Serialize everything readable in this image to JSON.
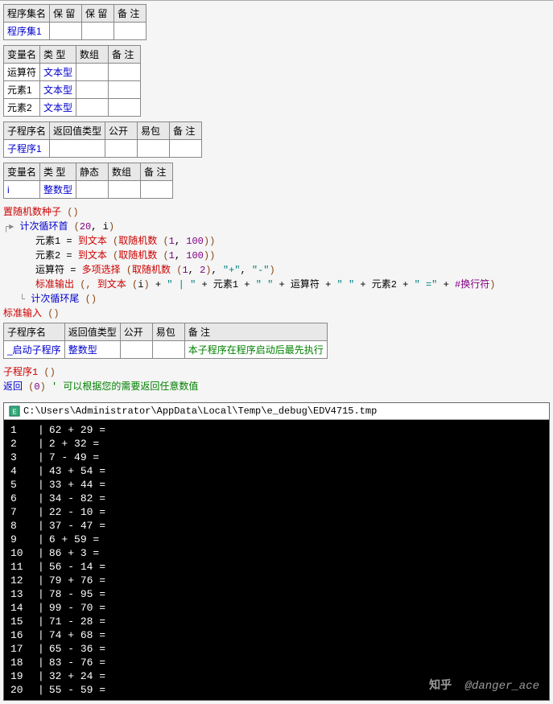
{
  "table1": {
    "headers": [
      "程序集名",
      "保 留",
      "保 留",
      "备 注"
    ],
    "rows": [
      [
        "程序集1",
        "",
        "",
        ""
      ]
    ]
  },
  "table2": {
    "headers": [
      "变量名",
      "类 型",
      "数组",
      "备 注"
    ],
    "rows": [
      [
        "运算符",
        "文本型",
        "",
        ""
      ],
      [
        "元素1",
        "文本型",
        "",
        ""
      ],
      [
        "元素2",
        "文本型",
        "",
        ""
      ]
    ]
  },
  "table3": {
    "headers": [
      "子程序名",
      "返回值类型",
      "公开",
      "易包",
      "备 注"
    ],
    "rows": [
      [
        "子程序1",
        "",
        "",
        "",
        ""
      ]
    ]
  },
  "table4": {
    "headers": [
      "变量名",
      "类 型",
      "静态",
      "数组",
      "备 注"
    ],
    "rows": [
      [
        "i",
        "整数型",
        "",
        "",
        ""
      ]
    ]
  },
  "table5": {
    "headers": [
      "子程序名",
      "返回值类型",
      "公开",
      "易包",
      "备 注"
    ],
    "rows": [
      [
        "_启动子程序",
        "整数型",
        "",
        "",
        "本子程序在程序启动后最先执行"
      ]
    ]
  },
  "code": {
    "line1": {
      "fn": "置随机数种子",
      "paren": " ()"
    },
    "line2": {
      "marker": "┌▸",
      "fn": "计次循环首",
      "args_open": " (",
      "n": "20",
      "sep": ", ",
      "var": "i",
      "close": ")"
    },
    "line3": {
      "var": "元素1",
      "assign": " = ",
      "fn1": "到文本",
      "open1": " (",
      "fn2": "取随机数",
      "open2": " (",
      "a": "1",
      "sep": ", ",
      "b": "100",
      "close": "))"
    },
    "line4": {
      "var": "元素2",
      "assign": " = ",
      "fn1": "到文本",
      "open1": " (",
      "fn2": "取随机数",
      "open2": " (",
      "a": "1",
      "sep": ", ",
      "b": "100",
      "close": "))"
    },
    "line5": {
      "var": "运算符",
      "assign": " = ",
      "fn1": "多项选择",
      "open1": " (",
      "fn2": "取随机数",
      "open2": " (",
      "a": "1",
      "sep": ", ",
      "b": "2",
      "close2": ")",
      "sep2": ", ",
      "s1": "\"+\"",
      "sep3": ", ",
      "s2": "\"-\"",
      "close": ")"
    },
    "line6": {
      "marker": "▸▸",
      "fn": "标准输出",
      "open": " (, ",
      "fn2": "到文本",
      "open2": " (",
      "var": "i",
      "close2": ")",
      "plus": " + ",
      "q1": "\" | \"",
      "plus2": " + ",
      "v1": "元素1",
      "plus3": " + ",
      "q2": "\" \"",
      "plus4": " + ",
      "v2": "运算符",
      "plus5": " + ",
      "q3": "\" \"",
      "plus6": " + ",
      "v3": "元素2",
      "plus7": " + ",
      "q4": "\" =\"",
      "plus8": " + ",
      "nl": "#换行符",
      "close": ")"
    },
    "line7": {
      "marker": "└",
      "fn": "计次循环尾",
      "paren": " ()"
    },
    "line8": {
      "fn": "标准输入",
      "paren": " ()"
    },
    "line9": {
      "fn": "子程序1",
      "paren": " ()"
    },
    "line10": {
      "fn": "返回",
      "open": " (",
      "val": "0",
      "close": ")",
      "comment": "'  可以根据您的需要返回任意数值"
    }
  },
  "console": {
    "title_path": "C:\\Users\\Administrator\\AppData\\Local\\Temp\\e_debug\\EDV4715.tmp",
    "lines": [
      {
        "n": "1",
        "a": "62",
        "op": "+",
        "b": "29"
      },
      {
        "n": "2",
        "a": "2",
        "op": "+",
        "b": "32"
      },
      {
        "n": "3",
        "a": "7",
        "op": "-",
        "b": "49"
      },
      {
        "n": "4",
        "a": "43",
        "op": "+",
        "b": "54"
      },
      {
        "n": "5",
        "a": "33",
        "op": "+",
        "b": "44"
      },
      {
        "n": "6",
        "a": "34",
        "op": "-",
        "b": "82"
      },
      {
        "n": "7",
        "a": "22",
        "op": "-",
        "b": "10"
      },
      {
        "n": "8",
        "a": "37",
        "op": "-",
        "b": "47"
      },
      {
        "n": "9",
        "a": "6",
        "op": "+",
        "b": "59"
      },
      {
        "n": "10",
        "a": "86",
        "op": "+",
        "b": "3"
      },
      {
        "n": "11",
        "a": "56",
        "op": "-",
        "b": "14"
      },
      {
        "n": "12",
        "a": "79",
        "op": "+",
        "b": "76"
      },
      {
        "n": "13",
        "a": "78",
        "op": "-",
        "b": "95"
      },
      {
        "n": "14",
        "a": "99",
        "op": "-",
        "b": "70"
      },
      {
        "n": "15",
        "a": "71",
        "op": "-",
        "b": "28"
      },
      {
        "n": "16",
        "a": "74",
        "op": "+",
        "b": "68"
      },
      {
        "n": "17",
        "a": "65",
        "op": "-",
        "b": "36"
      },
      {
        "n": "18",
        "a": "83",
        "op": "-",
        "b": "76"
      },
      {
        "n": "19",
        "a": "32",
        "op": "+",
        "b": "24"
      },
      {
        "n": "20",
        "a": "55",
        "op": "-",
        "b": "59"
      }
    ]
  },
  "watermark": {
    "logo": "知乎",
    "author": "@danger_ace"
  }
}
